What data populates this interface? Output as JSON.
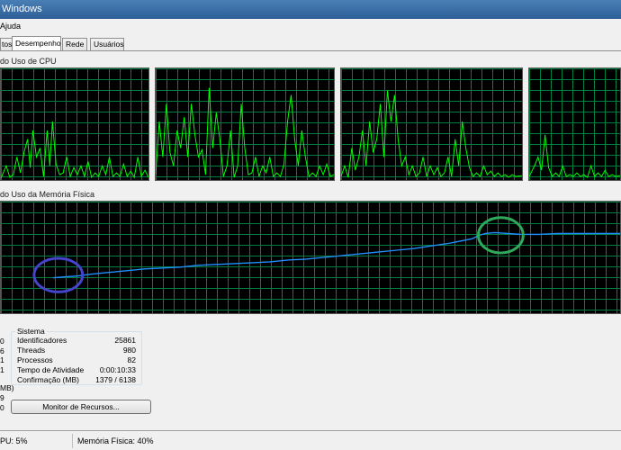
{
  "window": {
    "title": "Windows"
  },
  "menu": {
    "items": [
      "Ajuda"
    ]
  },
  "tabs": [
    {
      "label": "tos"
    },
    {
      "label": "Desempenho"
    },
    {
      "label": "Rede"
    },
    {
      "label": "Usuários"
    }
  ],
  "cpu": {
    "section_label": "do Uso de CPU"
  },
  "memory": {
    "section_label": "do Uso da Memória Física"
  },
  "left_values": [
    "0",
    "6",
    "1",
    "1",
    "9",
    "0"
  ],
  "left_mb_label": "MB)",
  "system": {
    "title": "Sistema",
    "rows": [
      {
        "label": "Identificadores",
        "value": "25861"
      },
      {
        "label": "Threads",
        "value": "980"
      },
      {
        "label": "Processos",
        "value": "82"
      },
      {
        "label": "Tempo de Atividade",
        "value": "0:00:10:33"
      },
      {
        "label": "Confirmação (MB)",
        "value": "1379 / 6138"
      }
    ]
  },
  "resource_monitor_button": "Monitor de Recursos...",
  "status": {
    "cpu": "PU: 5%",
    "memory": "Memória Física: 40%"
  },
  "colors": {
    "graph_grid": "#008040",
    "cpu_line": "#00ff00",
    "memory_line": "#1e90ff",
    "circle_blue": "#4444cc",
    "circle_green": "#2eaa5a"
  }
}
